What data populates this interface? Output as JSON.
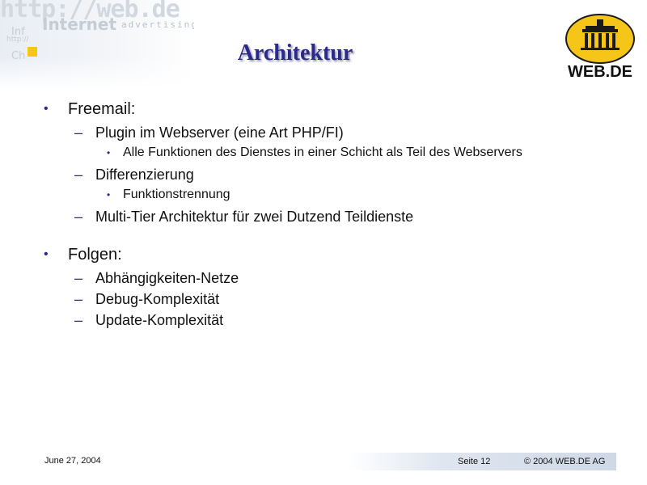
{
  "slide": {
    "title": "Architektur",
    "decor": {
      "url_text": "http://web.de",
      "internet_text": "Internet",
      "advertising_text": "advertising",
      "small_1": "Inf",
      "small_2": "http://",
      "small_3": "Ch",
      "accent_color": "#f5c518"
    },
    "logo": {
      "text": "WEB.DE",
      "circle_color": "#f5c518",
      "icon": "brandenburg-gate-icon"
    },
    "sections": [
      {
        "label": "Freemail:",
        "items": [
          {
            "label": "Plugin im Webserver (eine Art PHP/FI)",
            "subitems": [
              "Alle Funktionen des Dienstes in einer Schicht als Teil des Webservers"
            ]
          },
          {
            "label": "Differenzierung",
            "subitems": [
              "Funktionstrennung"
            ]
          },
          {
            "label": "Multi-Tier Architektur für zwei Dutzend Teildienste",
            "subitems": []
          }
        ]
      },
      {
        "label": "Folgen:",
        "items": [
          {
            "label": "Abhängigkeiten-Netze",
            "subitems": []
          },
          {
            "label": "Debug-Komplexität",
            "subitems": []
          },
          {
            "label": "Update-Komplexität",
            "subitems": []
          }
        ]
      }
    ],
    "footer": {
      "date": "June 27, 2004",
      "page": "Seite 12",
      "copyright": "© 2004 WEB.DE AG"
    },
    "colors": {
      "title": "#2a2a8c",
      "bullet": "#2a2a8c"
    }
  }
}
